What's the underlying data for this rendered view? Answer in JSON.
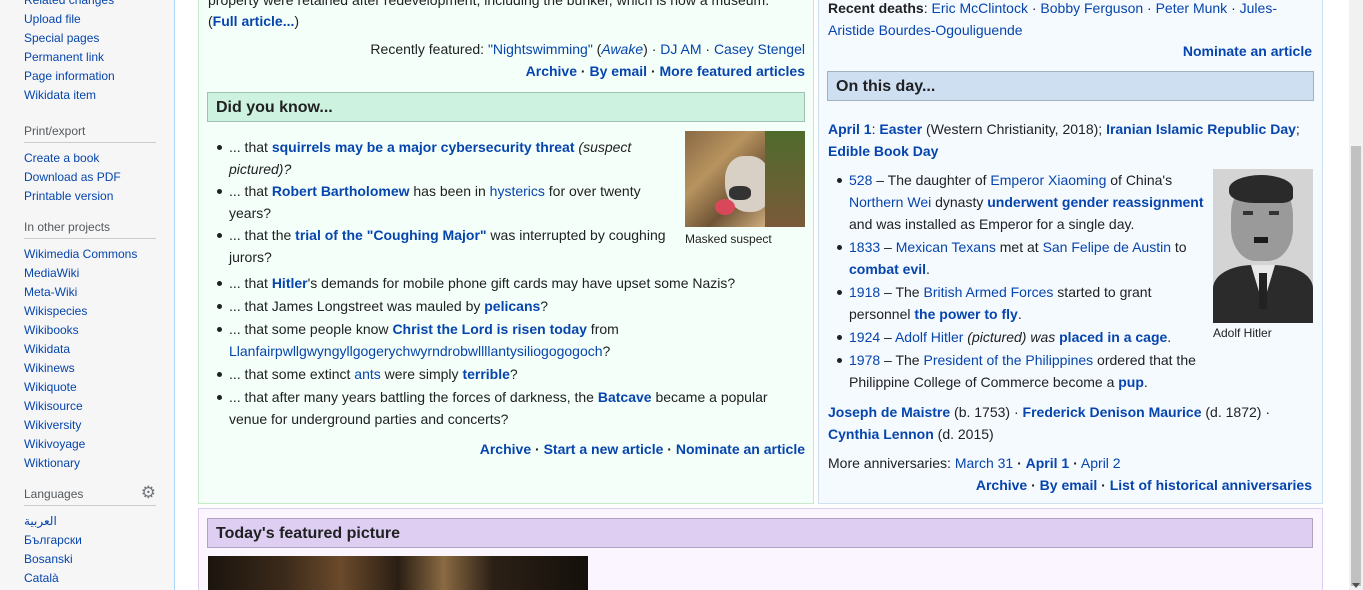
{
  "sidebar": {
    "tools_items": [
      "Related changes",
      "Upload file",
      "Special pages",
      "Permanent link",
      "Page information",
      "Wikidata item"
    ],
    "print_heading": "Print/export",
    "print_items": [
      "Create a book",
      "Download as PDF",
      "Printable version"
    ],
    "projects_heading": "In other projects",
    "projects_items": [
      "Wikimedia Commons",
      "MediaWiki",
      "Meta-Wiki",
      "Wikispecies",
      "Wikibooks",
      "Wikidata",
      "Wikinews",
      "Wikiquote",
      "Wikisource",
      "Wikiversity",
      "Wikivoyage",
      "Wiktionary"
    ],
    "languages_heading": "Languages",
    "languages_items": [
      "العربية",
      "Български",
      "Bosanski",
      "Català"
    ]
  },
  "featured_article": {
    "tail_text": "property were retained after redevelopment, including the bunker, which is now a museum.",
    "full_article": "Full article...",
    "recently_label": "Recently featured: ",
    "recent_items": [
      "\"Nightswimming\"",
      "Awake",
      "DJ AM",
      "Casey Stengel"
    ],
    "links": [
      "Archive",
      "By email",
      "More featured articles"
    ]
  },
  "dyk": {
    "heading": "Did you know...",
    "image_caption": "Masked suspect",
    "items": [
      {
        "a": "... that ",
        "b": "squirrels may be a major cybersecurity threat",
        "c": " (suspect pictured)?"
      },
      {
        "a": "... that ",
        "b": "Robert Bartholomew",
        "c": " has been in ",
        "d": "hysterics",
        "e": " for over twenty years?"
      },
      {
        "a": "... that the ",
        "b": "trial of the \"Coughing Major\"",
        "c": " was interrupted by coughing jurors?"
      },
      {
        "a": "... that ",
        "b": "Hitler",
        "c": "'s demands for mobile phone gift cards may have upset some Nazis?"
      },
      {
        "a": "... that James Longstreet was mauled by ",
        "b": "pelicans",
        "c": "?"
      },
      {
        "a": "... that some people know ",
        "b": "Christ the Lord is risen today",
        "c": " from ",
        "d": "Llanfairpwllgwyngyllgogerychwyrndrobwllllantysiliogogogoch",
        "e": "?"
      },
      {
        "a": "... that some extinct ",
        "b": "ants",
        "c": " were simply ",
        "d": "terrible",
        "e": "?"
      },
      {
        "a": "... that after many years battling the forces of darkness, the ",
        "b": "Batcave",
        "c": " became a popular venue for underground parties and concerts?"
      }
    ],
    "links": [
      "Archive",
      "Start a new article",
      "Nominate an article"
    ]
  },
  "in_the_news": {
    "recent_deaths_label": "Recent deaths",
    "deaths": [
      "Eric McClintock",
      "Bobby Ferguson",
      "Peter Munk",
      "Jules-Aristide Bourdes-Ogouliguende"
    ],
    "nominate": "Nominate an article"
  },
  "on_this_day": {
    "heading": "On this day...",
    "date": "April 1",
    "holiday1": "Easter",
    "holiday1_note": " (Western Christianity, 2018); ",
    "holiday2": "Iranian Islamic Republic Day",
    "holiday3": "Edible Book Day",
    "image_caption": "Adolf Hitler",
    "events": [
      {
        "year": "528",
        "t1": " – The daughter of ",
        "l1": "Emperor Xiaoming",
        "t2": " of China's ",
        "l2": "Northern Wei",
        "t3": " dynasty ",
        "l3": "underwent gender reassignment",
        "t4": " and was installed as Emperor for a single day."
      },
      {
        "year": "1833",
        "t1": " – ",
        "l1": "Mexican Texans",
        "t2": " met at ",
        "l2": "San Felipe de Austin",
        "t3": " to ",
        "l3": "combat evil",
        "t4": "."
      },
      {
        "year": "1918",
        "t1": " – The ",
        "l1": "British Armed Forces",
        "t2": " started to grant personnel ",
        "l2": "",
        "t3": "",
        "l3": "the power to fly",
        "t4": "."
      },
      {
        "year": "1924",
        "t1": " – ",
        "l1": "Adolf Hitler",
        "t2": " (pictured) was ",
        "l2": "",
        "t3": "",
        "l3": "placed in a cage",
        "t4": "."
      },
      {
        "year": "1978",
        "t1": " – The ",
        "l1": "President of the Philippines",
        "t2": " ordered that the Philippine College of Commerce become a ",
        "l2": "",
        "t3": "",
        "l3": "pup",
        "t4": "."
      }
    ],
    "births": [
      {
        "name": "Joseph de Maistre",
        "note": " (b. 1753)"
      },
      {
        "name": "Frederick Denison Maurice",
        "note": " (d. 1872)"
      },
      {
        "name": "Cynthia Lennon",
        "note": " (d. 2015)"
      }
    ],
    "more_label": "More anniversaries: ",
    "more_items": [
      "March 31",
      "April 1",
      "April 2"
    ],
    "links": [
      "Archive",
      "By email",
      "List of historical anniversaries"
    ]
  },
  "featured_picture": {
    "heading": "Today's featured picture"
  }
}
